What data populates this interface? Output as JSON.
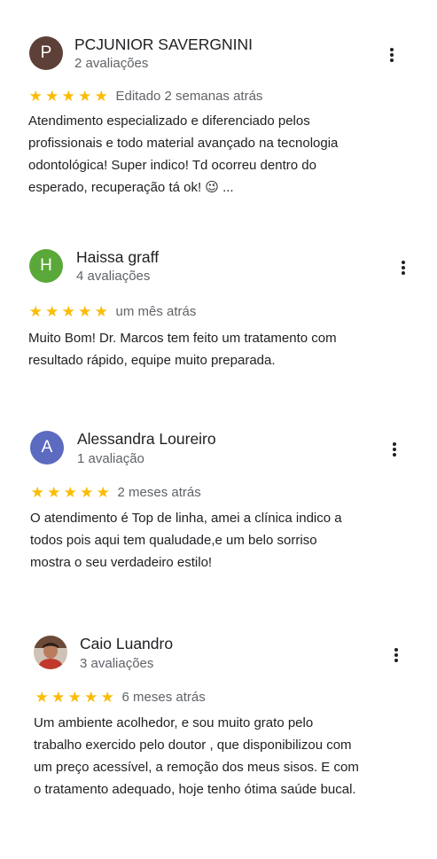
{
  "reviews": [
    {
      "avatar_letter": "P",
      "avatar_color": "#5d4037",
      "name": "PCJUNIOR SAVERGNINI",
      "count": "2 avaliações",
      "rating": 5,
      "when": "Editado 2 semanas atrás",
      "lines": [
        "Atendimento especializado e diferenciado pelos",
        "profissionais e todo  material avançado na tecnologia",
        "odontológica! Super indico! Td ocorreu dentro do",
        "esperado, recuperação tá ok! 😉 ..."
      ]
    },
    {
      "avatar_letter": "H",
      "avatar_color": "#5aa839",
      "name": "Haissa graff",
      "count": "4 avaliações",
      "rating": 5,
      "when": "um mês atrás",
      "lines": [
        "Muito Bom! Dr. Marcos tem feito um tratamento com",
        "resultado rápido, equipe muito preparada."
      ]
    },
    {
      "avatar_letter": "A",
      "avatar_color": "#5c6bc0",
      "name": "Alessandra Loureiro",
      "count": "1 avaliação",
      "rating": 5,
      "when": "2 meses atrás",
      "lines": [
        "O atendimento é Top de linha, amei a clínica indico a",
        "todos pois aqui tem qualudade,e um belo sorriso",
        "mostra o seu verdadeiro estilo!"
      ]
    },
    {
      "avatar_letter": "",
      "avatar_color": "#8d5a4a",
      "name": "Caio Luandro",
      "count": "3 avaliações",
      "rating": 5,
      "when": "6 meses atrás",
      "lines": [
        "Um ambiente acolhedor, e sou muito grato pelo",
        "trabalho exercido pelo doutor , que disponibilizou com",
        "um preço acessível, a remoção dos meus sisos. E com",
        "o tratamento adequado, hoje tenho ótima saúde bucal."
      ]
    }
  ],
  "star_glyph": "★",
  "more_icon": "more-vert-icon",
  "star_color": "#fbbc04"
}
